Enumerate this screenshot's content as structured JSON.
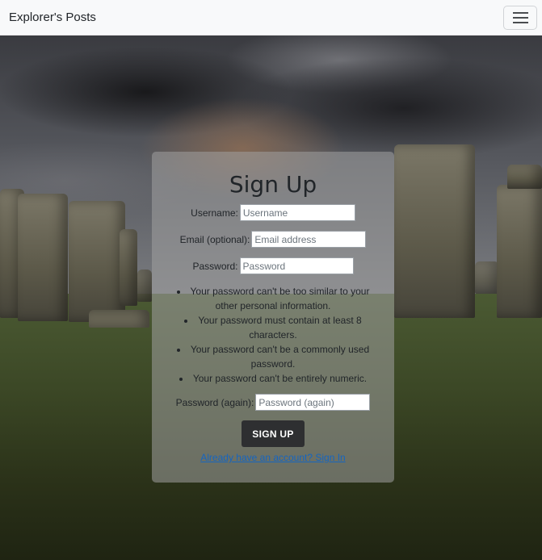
{
  "navbar": {
    "brand": "Explorer's Posts",
    "toggle_icon": "hamburger-menu-icon"
  },
  "form": {
    "title": "Sign Up",
    "username": {
      "label": "Username:",
      "placeholder": "Username",
      "value": ""
    },
    "email": {
      "label": "Email (optional):",
      "placeholder": "Email address",
      "value": ""
    },
    "password": {
      "label": "Password:",
      "placeholder": "Password",
      "value": ""
    },
    "help": [
      "Your password can't be too similar to your other personal information.",
      "Your password must contain at least 8 characters.",
      "Your password can't be a commonly used password.",
      "Your password can't be entirely numeric."
    ],
    "password2": {
      "label": "Password (again):",
      "placeholder": "Password (again)",
      "value": ""
    },
    "submit_label": "SIGN UP",
    "signin_link": "Already have an account? Sign In"
  },
  "colors": {
    "navbar_bg": "#f8f9fa",
    "button_bg": "#2e2f31",
    "link": "#1565c0"
  }
}
